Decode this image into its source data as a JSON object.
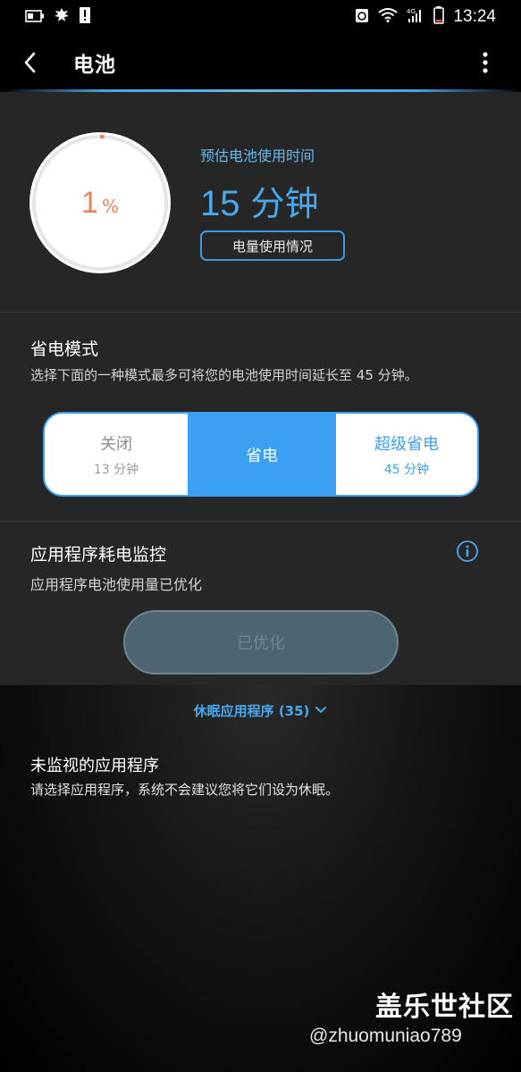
{
  "status_bar": {
    "time": "13:24",
    "left_icons": [
      "battery-saver-icon",
      "leaf-icon",
      "alert-icon"
    ],
    "right_icons": [
      "recycle-icon",
      "wifi-icon",
      "signal-4g-icon",
      "battery-low-icon"
    ],
    "network": "4G"
  },
  "app_bar": {
    "title": "电池"
  },
  "battery": {
    "percent": 1,
    "percent_value": "1",
    "percent_unit": "%",
    "ring_color": "#e8845b",
    "est_label": "预估电池使用时间",
    "est_value": "15",
    "est_unit": "分钟",
    "usage_button": "电量使用情况"
  },
  "power_mode": {
    "title": "省电模式",
    "description": "选择下面的一种模式最多可将您的电池使用时间延长至 45 分钟。",
    "options": [
      {
        "label": "关闭",
        "sub": "13 分钟",
        "selected": false
      },
      {
        "label": "省电",
        "sub": "",
        "selected": true
      },
      {
        "label": "超级省电",
        "sub": "45 分钟",
        "selected": false
      }
    ],
    "accent": "#3ba0f3"
  },
  "app_monitor": {
    "title": "应用程序耗电监控",
    "description": "应用程序电池使用量已优化",
    "button": "已优化"
  },
  "sleeping_apps": {
    "label": "休眠应用程序 (35)"
  },
  "unmonitored": {
    "title": "未监视的应用程序",
    "description": "请选择应用程序，系统不会建议您将它们设为休眠。"
  },
  "watermark": {
    "title": "盖乐世社区",
    "handle": "@zhuomuniao789"
  }
}
